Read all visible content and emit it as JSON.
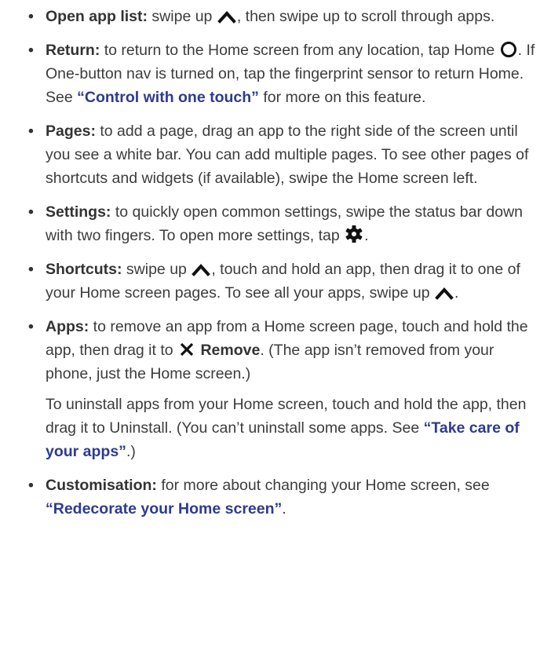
{
  "colors": {
    "text": "#3c3c3c",
    "term": "#333333",
    "link": "#2e3b8f"
  },
  "bullet_glyph": "•",
  "items": [
    {
      "term": "Open app list:",
      "t1": " swipe up ",
      "icon": "chevron-up-icon",
      "t2": ", then swipe up to scroll through apps."
    },
    {
      "term": "Return:",
      "t1": " to return to the Home screen from any location, tap Home ",
      "icon": "home-circle-icon",
      "t2": ". If One-button nav is turned on, tap the fingerprint sensor to return Home. See ",
      "link": "“Control with one touch”",
      "t3": " for more on this feature."
    },
    {
      "term": "Pages:",
      "t1": " to add a page, drag an app to the right side of the screen until you see a white bar. You can add multiple pages. To see other pages of shortcuts and widgets (if available), swipe the Home screen left."
    },
    {
      "term": "Settings:",
      "t1": " to quickly open common settings, swipe the status bar down with two fingers. To open more settings, tap ",
      "icon": "gear-icon",
      "t2": "."
    },
    {
      "term": "Shortcuts:",
      "t1": " swipe up ",
      "icon": "chevron-up-icon",
      "t2": ", touch and hold an app, then drag it to one of your Home screen pages. To see all your apps, swipe up ",
      "icon2": "chevron-up-icon",
      "t3": "."
    },
    {
      "term": "Apps:",
      "t1": " to remove an app from a Home screen page, touch and hold the app, then drag it to ",
      "icon": "close-icon",
      "remove_label": "Remove",
      "t2": ". (The app isn’t removed from your phone, just the Home screen.)",
      "follow_t1": "To uninstall apps from your Home screen, touch and hold the app, then drag it to Uninstall. (You can’t uninstall some apps. See ",
      "follow_link": "“Take care of your apps”",
      "follow_t2": ".)"
    },
    {
      "term": "Customisation:",
      "t1": " for more about changing your Home screen, see ",
      "link": "“Redecorate your Home screen”",
      "t2": "."
    }
  ]
}
